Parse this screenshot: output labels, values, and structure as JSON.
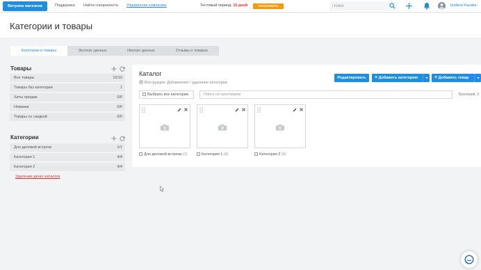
{
  "topbar": {
    "brand": "Витрина магазина",
    "links": [
      "Поддержка",
      "Найти специалиста"
    ],
    "manage_link": "Управление компанию",
    "trial_text": "Тестовый период:",
    "trial_days": "10 дней",
    "pay_button": "ПОПОЛНИТЬ",
    "search_placeholder": "Поиск",
    "username": "testtest Kasaka"
  },
  "page_title": "Категории и товары",
  "tabs": [
    {
      "label": "Категории и товары",
      "active": true
    },
    {
      "label": "Экспорт данных",
      "active": false
    },
    {
      "label": "Импорт данных",
      "active": false
    },
    {
      "label": "Отзывы о товарах",
      "active": false
    }
  ],
  "goods": {
    "title": "Товары",
    "items": [
      {
        "label": "Все товары",
        "count": "10/10"
      },
      {
        "label": "Товары без категории",
        "count": "1"
      },
      {
        "label": "Хиты продаж",
        "count": "0/0"
      },
      {
        "label": "Новинки",
        "count": "0/0"
      },
      {
        "label": "Товары со скидкой",
        "count": "0/0"
      }
    ]
  },
  "categories": {
    "title": "Категории",
    "items": [
      {
        "label": "Для деловой встречи",
        "count": "1/1"
      },
      {
        "label": "Категория 1",
        "count": "4/4"
      },
      {
        "label": "Категория 2",
        "count": "4/4"
      }
    ],
    "delete_link": "Удаление денег каталога"
  },
  "catalog": {
    "title": "Каталог",
    "help": "Инструкция. Добавление / удаление категории",
    "edit_button": "Редактировать",
    "add_category_button": "Добавить категорию",
    "add_product_button": "Добавить товар",
    "select_all": "Выбрать все категории",
    "search_placeholder": "Поиск по категориям",
    "count_text": "Категорий, 3",
    "cards": [
      {
        "name": "Для деловой встречи",
        "count": "(1)"
      },
      {
        "name": "Категория 1",
        "count": "(4)"
      },
      {
        "name": "Категория 2",
        "count": "(4)"
      }
    ]
  },
  "colors": {
    "accent": "#1f8ee0",
    "warning": "#ff9800",
    "danger": "#e03131"
  }
}
